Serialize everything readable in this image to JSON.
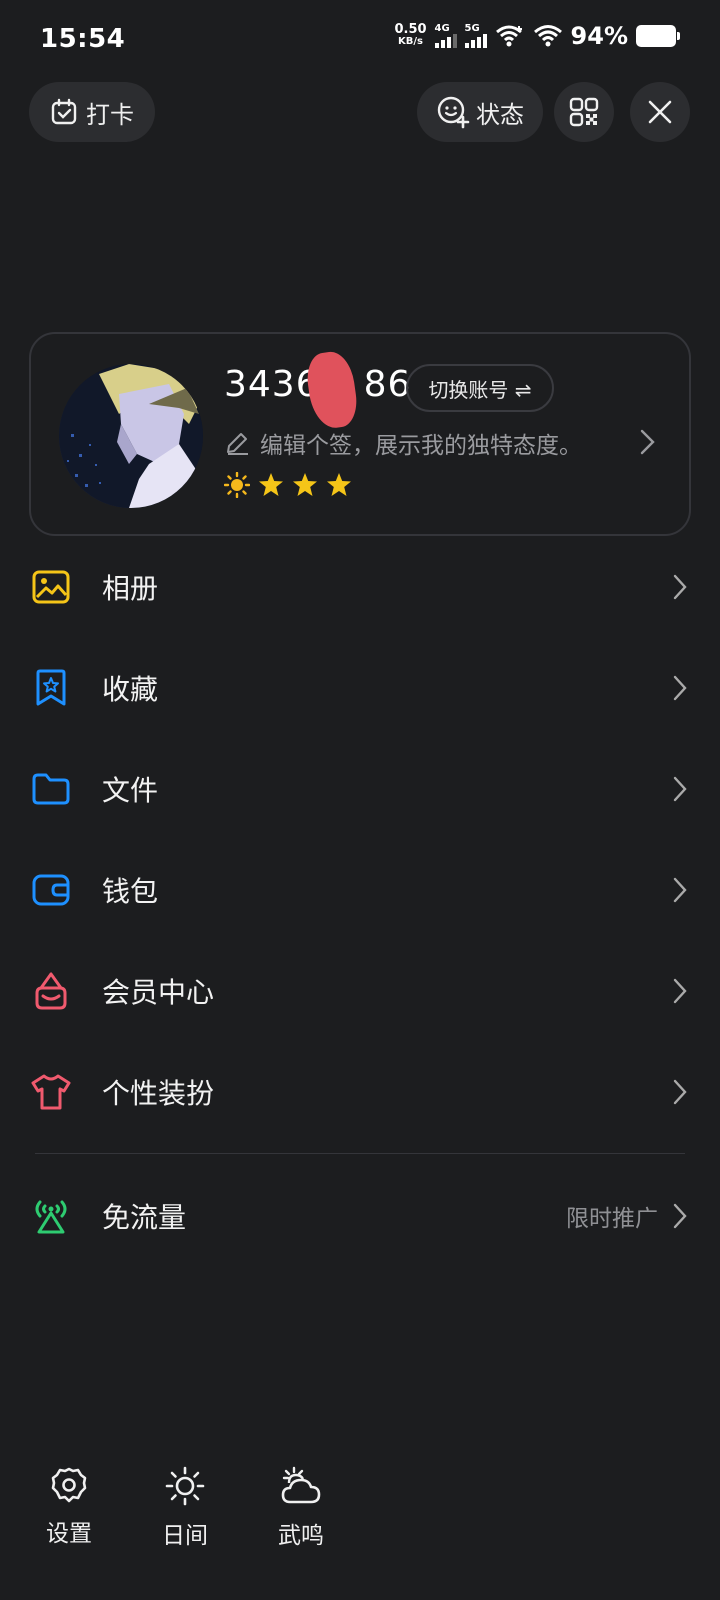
{
  "status_bar": {
    "time": "15:54",
    "net_speed": "0.50",
    "net_speed_unit": "KB/s",
    "sim1": "4G",
    "sim2": "5G",
    "battery_pct": "94%"
  },
  "top_actions": {
    "checkin_label": "打卡",
    "status_label": "状态",
    "qr_icon": "qr-code-icon",
    "close_icon": "close-icon"
  },
  "profile": {
    "username_prefix": "3436",
    "username_suffix": "86",
    "switch_label": "切换账号 ⇌",
    "signature": "编辑个签，展示我的独特态度。",
    "level_icons": [
      "sun-icon",
      "star-icon",
      "star-icon",
      "star-icon"
    ]
  },
  "menu": {
    "items": [
      {
        "label": "相册",
        "icon": "photo-album-icon",
        "color": "#f5c518"
      },
      {
        "label": "收藏",
        "icon": "favorites-icon",
        "color": "#1e90ff"
      },
      {
        "label": "文件",
        "icon": "folder-icon",
        "color": "#1e90ff"
      },
      {
        "label": "钱包",
        "icon": "wallet-icon",
        "color": "#1e90ff"
      },
      {
        "label": "会员中心",
        "icon": "vip-icon",
        "color": "#f05a6e"
      },
      {
        "label": "个性装扮",
        "icon": "tshirt-icon",
        "color": "#f05a6e"
      }
    ],
    "free_traffic": {
      "label": "免流量",
      "aside": "限时推广",
      "icon": "broadcast-icon",
      "color": "#2ecc71"
    }
  },
  "bottom_bar": {
    "settings": "设置",
    "daytime": "日间",
    "weather": "武鸣"
  }
}
